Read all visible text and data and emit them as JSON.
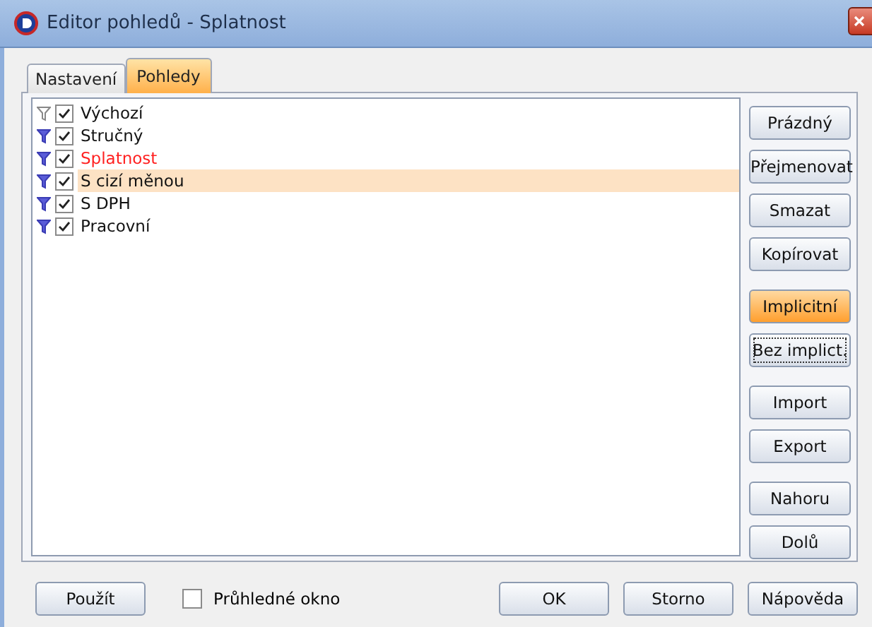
{
  "window": {
    "title": "Editor pohledů - Splatnost"
  },
  "tabs": [
    {
      "label": "Nastavení",
      "selected": false
    },
    {
      "label": "Pohledy",
      "selected": true
    }
  ],
  "views": [
    {
      "label": "Výchozí",
      "checked": true,
      "filter_active": false,
      "current": false,
      "selected": false
    },
    {
      "label": "Stručný",
      "checked": true,
      "filter_active": true,
      "current": false,
      "selected": false
    },
    {
      "label": "Splatnost",
      "checked": true,
      "filter_active": true,
      "current": true,
      "selected": false
    },
    {
      "label": "S cizí měnou",
      "checked": true,
      "filter_active": true,
      "current": false,
      "selected": true
    },
    {
      "label": "S DPH",
      "checked": true,
      "filter_active": true,
      "current": false,
      "selected": false
    },
    {
      "label": "Pracovní",
      "checked": true,
      "filter_active": true,
      "current": false,
      "selected": false
    }
  ],
  "side_button_groups": [
    [
      {
        "label": "Prázdný",
        "highlighted": false,
        "focused": false
      },
      {
        "label": "Přejmenovat",
        "highlighted": false,
        "focused": false
      },
      {
        "label": "Smazat",
        "highlighted": false,
        "focused": false
      },
      {
        "label": "Kopírovat",
        "highlighted": false,
        "focused": false
      }
    ],
    [
      {
        "label": "Implicitní",
        "highlighted": true,
        "focused": false
      },
      {
        "label": "Bez implict.",
        "highlighted": false,
        "focused": true
      }
    ],
    [
      {
        "label": "Import",
        "highlighted": false,
        "focused": false
      },
      {
        "label": "Export",
        "highlighted": false,
        "focused": false
      }
    ],
    [
      {
        "label": "Nahoru",
        "highlighted": false,
        "focused": false
      },
      {
        "label": "Dolů",
        "highlighted": false,
        "focused": false
      }
    ]
  ],
  "apply_button": "Použít",
  "transparent_window": {
    "label": "Průhledné okno",
    "checked": false
  },
  "dialog_buttons": [
    "OK",
    "Storno",
    "Nápověda"
  ]
}
